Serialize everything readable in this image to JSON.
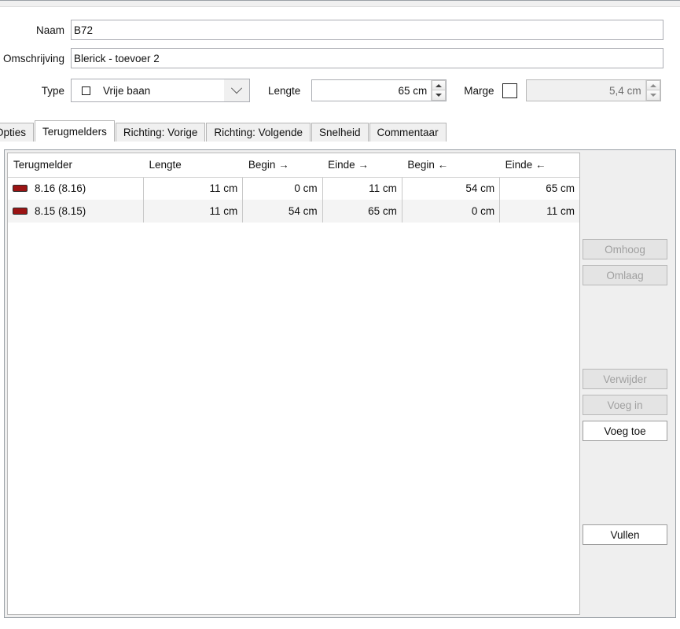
{
  "form": {
    "naam": {
      "label": "Naam",
      "value": "B72"
    },
    "omschrijving": {
      "label": "Omschrijving",
      "value": "Blerick - toevoer 2"
    },
    "type": {
      "label": "Type",
      "value": "Vrije baan",
      "icon": "square-outline-icon",
      "arrow": "chevron-down-icon"
    },
    "lengte": {
      "label": "Lengte",
      "value": "65 cm"
    },
    "marge": {
      "label": "Marge",
      "checked": false,
      "value": "5,4 cm"
    }
  },
  "tabs": [
    {
      "label": "Opties",
      "active": false
    },
    {
      "label": "Terugmelders",
      "active": true
    },
    {
      "label": "Richting: Vorige",
      "active": false
    },
    {
      "label": "Richting: Volgende",
      "active": false
    },
    {
      "label": "Snelheid",
      "active": false
    },
    {
      "label": "Commentaar",
      "active": false
    }
  ],
  "table": {
    "columns": [
      "Terugmelder",
      "Lengte",
      "Begin →",
      "Einde →",
      "Begin ←",
      "Einde ←"
    ],
    "rows": [
      {
        "terugmelder": "8.16 (8.16)",
        "lengte": "11 cm",
        "begin_fwd": "0 cm",
        "einde_fwd": "11 cm",
        "begin_bwd": "54 cm",
        "einde_bwd": "65 cm"
      },
      {
        "terugmelder": "8.15 (8.15)",
        "lengte": "11 cm",
        "begin_fwd": "54 cm",
        "einde_fwd": "65 cm",
        "begin_bwd": "0 cm",
        "einde_bwd": "11 cm"
      }
    ]
  },
  "buttons": {
    "omhoog": {
      "label": "Omhoog",
      "enabled": false
    },
    "omlaag": {
      "label": "Omlaag",
      "enabled": false
    },
    "verwijder": {
      "label": "Verwijder",
      "enabled": false
    },
    "voeg_in": {
      "label": "Voeg in",
      "enabled": false
    },
    "voeg_toe": {
      "label": "Voeg toe",
      "enabled": true
    },
    "vullen": {
      "label": "Vullen",
      "enabled": true
    }
  },
  "colors": {
    "feedback_marker": "#9b1414",
    "panel_bg": "#efefef",
    "field_border": "#abadb3"
  }
}
